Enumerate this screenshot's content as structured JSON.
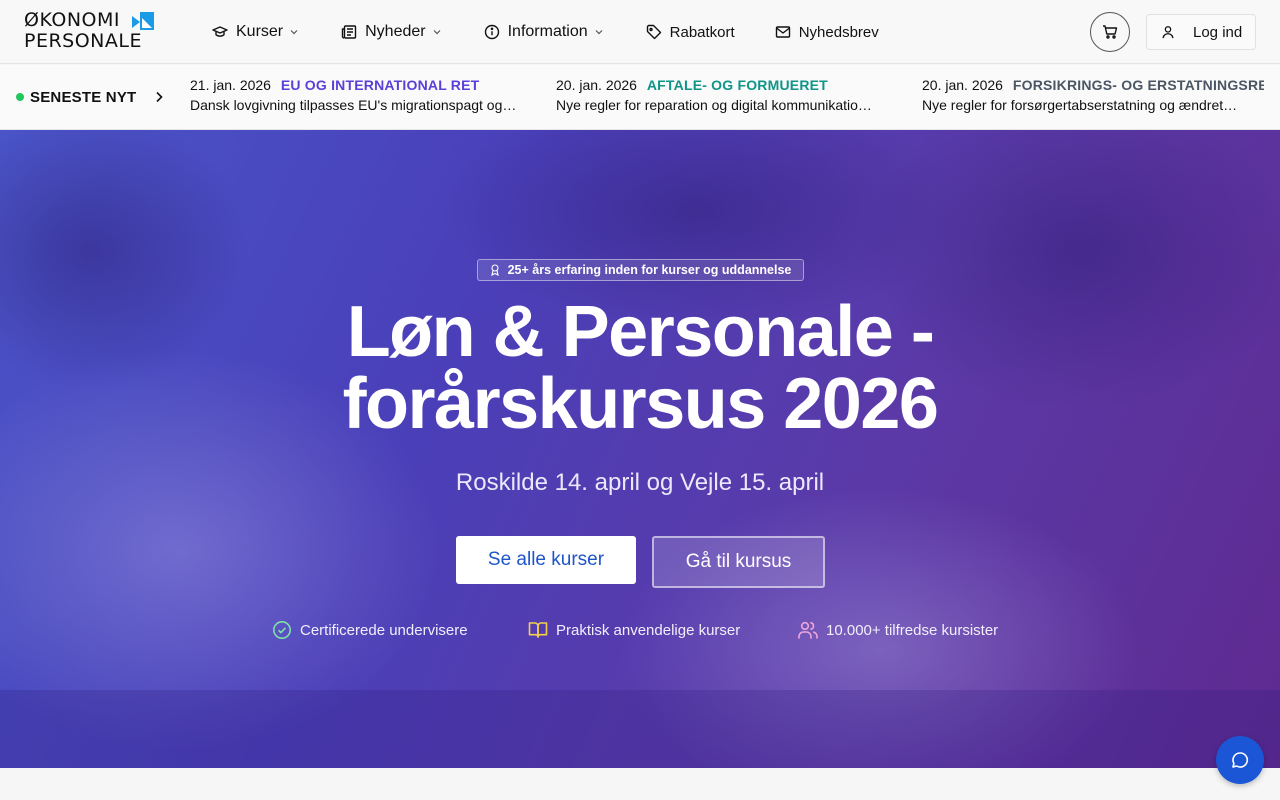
{
  "brand": {
    "logo_line1": "ØKONOMI",
    "logo_line2": "PERSONALE",
    "logo_accent_color": "#1a9be6"
  },
  "nav": {
    "items": [
      {
        "label": "Kurser",
        "icon": "graduation-cap-icon",
        "dropdown": true
      },
      {
        "label": "Nyheder",
        "icon": "newspaper-icon",
        "dropdown": true
      },
      {
        "label": "Information",
        "icon": "info-circle-icon",
        "dropdown": true
      },
      {
        "label": "Rabatkort",
        "icon": "tag-icon",
        "dropdown": false
      },
      {
        "label": "Nyhedsbrev",
        "icon": "envelope-icon",
        "dropdown": false
      }
    ],
    "cart_icon": "shopping-cart-icon",
    "login_label": "Log ind"
  },
  "ticker": {
    "heading": "SENESTE NYT",
    "items": [
      {
        "date": "21. jan. 2026",
        "category": "EU OG INTERNATIONAL RET",
        "category_color": "#5b3fd6",
        "title": "Dansk lovgivning tilpasses EU's migrationspagt og…"
      },
      {
        "date": "20. jan. 2026",
        "category": "AFTALE- OG FORMUERET",
        "category_color": "#0f9488",
        "title": "Nye regler for reparation og digital kommunikatio…"
      },
      {
        "date": "20. jan. 2026",
        "category": "FORSIKRINGS- OG ERSTATNINGSRE",
        "category_color": "#4b5563",
        "title": "Nye regler for forsørgertabserstatning og ændret…"
      }
    ]
  },
  "hero": {
    "badge": "25+ års erfaring inden for kurser og uddannelse",
    "title_line1": "Løn & Personale -",
    "title_line2": "forårskursus 2026",
    "subtitle": "Roskilde 14. april og Vejle 15. april",
    "primary_button": "Se alle kurser",
    "secondary_button": "Gå til kursus",
    "features": [
      {
        "label": "Certificerede undervisere",
        "icon": "check-circle-icon",
        "color": "#7ee2a8"
      },
      {
        "label": "Praktisk anvendelige kurser",
        "icon": "open-book-icon",
        "color": "#f5d04a"
      },
      {
        "label": "10.000+ tilfredse kursister",
        "icon": "users-icon",
        "color": "#f0a6d8"
      }
    ]
  },
  "chat": {
    "icon": "chat-bubble-icon"
  }
}
